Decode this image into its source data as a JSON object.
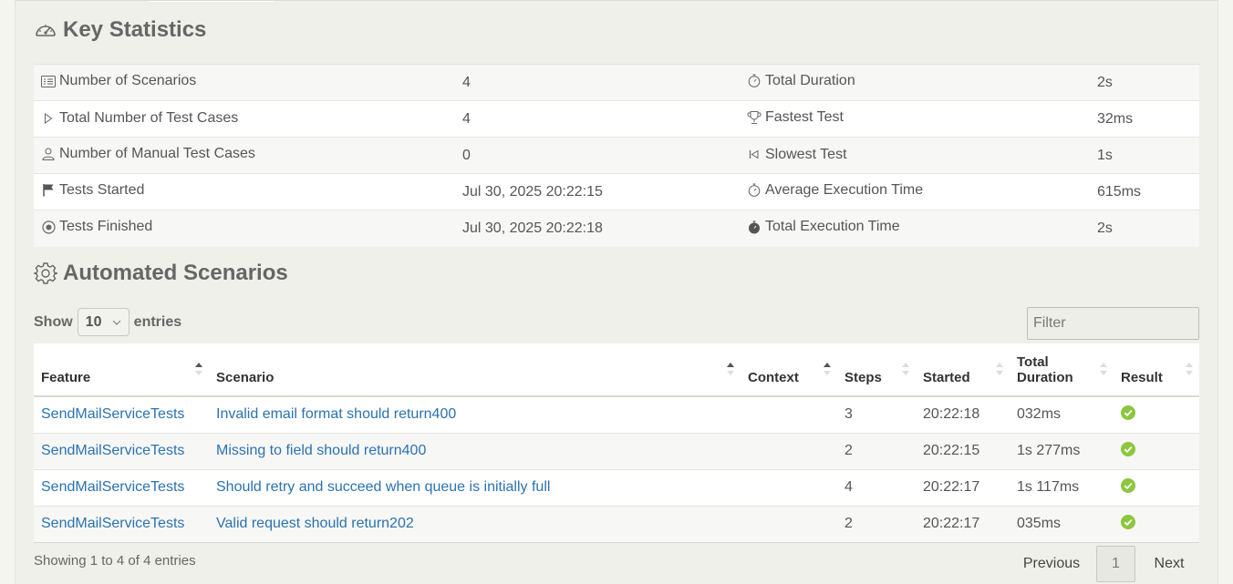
{
  "key_statistics": {
    "title": "Key Statistics",
    "rows": [
      {
        "label": "Number of Scenarios",
        "value": "4",
        "label2": "Total Duration",
        "value2": "2s"
      },
      {
        "label": "Total Number of Test Cases",
        "value": "4",
        "label2": "Fastest Test",
        "value2": "32ms"
      },
      {
        "label": "Number of Manual Test Cases",
        "value": "0",
        "label2": "Slowest Test",
        "value2": "1s"
      },
      {
        "label": "Tests Started",
        "value": "Jul 30, 2025 20:22:15",
        "label2": "Average Execution Time",
        "value2": "615ms"
      },
      {
        "label": "Tests Finished",
        "value": "Jul 30, 2025 20:22:18",
        "label2": "Total Execution Time",
        "value2": "2s"
      }
    ]
  },
  "automated": {
    "title": "Automated Scenarios",
    "show_label": "Show",
    "entries_value": "10",
    "entries_label": "entries",
    "filter_placeholder": "Filter",
    "columns": {
      "feature": "Feature",
      "scenario": "Scenario",
      "context": "Context",
      "steps": "Steps",
      "started": "Started",
      "total_duration_line1": "Total",
      "total_duration_line2": "Duration",
      "result": "Result"
    },
    "rows": [
      {
        "feature": "SendMailServiceTests",
        "scenario": "Invalid email format should return400",
        "context": "",
        "steps": "3",
        "started": "20:22:18",
        "duration": "032ms"
      },
      {
        "feature": "SendMailServiceTests",
        "scenario": "Missing to field should return400",
        "context": "",
        "steps": "2",
        "started": "20:22:15",
        "duration": "1s 277ms"
      },
      {
        "feature": "SendMailServiceTests",
        "scenario": "Should retry and succeed when queue is initially full",
        "context": "",
        "steps": "4",
        "started": "20:22:17",
        "duration": "1s 117ms"
      },
      {
        "feature": "SendMailServiceTests",
        "scenario": "Valid request should return202",
        "context": "",
        "steps": "2",
        "started": "20:22:17",
        "duration": "035ms"
      }
    ],
    "info": "Showing 1 to 4 of 4 entries",
    "pagination": {
      "previous": "Previous",
      "current": "1",
      "next": "Next"
    }
  },
  "colors": {
    "link": "#2b72b0",
    "pass": "#8cc63f"
  }
}
